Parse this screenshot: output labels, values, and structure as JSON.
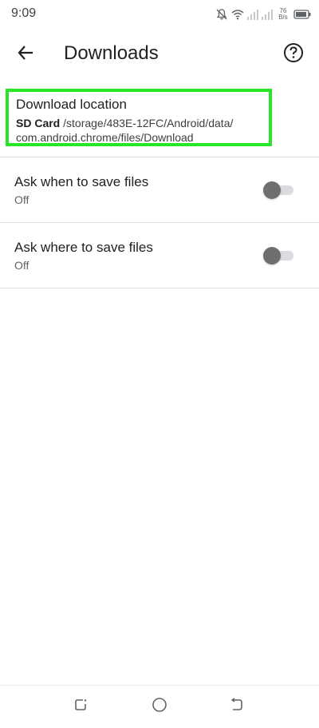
{
  "status_bar": {
    "time": "9:09",
    "net_speed_value": "76",
    "net_speed_unit": "B/s",
    "icons": [
      "notifications-off-icon",
      "wifi-icon",
      "signal-icon",
      "signal-icon",
      "battery-icon"
    ]
  },
  "app_bar": {
    "title": "Downloads",
    "back_icon": "arrow-back-icon",
    "help_icon": "help-icon"
  },
  "download_location": {
    "title": "Download location",
    "storage_name": "SD Card",
    "path_line1": " /storage/483E-12FC/Android/data/",
    "path_line2": "com.android.chrome/files/Download",
    "highlight_color": "#27e627"
  },
  "settings": [
    {
      "title": "Ask when to save files",
      "summary": "Off",
      "enabled": false
    },
    {
      "title": "Ask where to save files",
      "summary": "Off",
      "enabled": false
    }
  ],
  "nav_bar": {
    "icons": [
      "recent-apps-icon",
      "home-icon",
      "back-nav-icon"
    ]
  }
}
